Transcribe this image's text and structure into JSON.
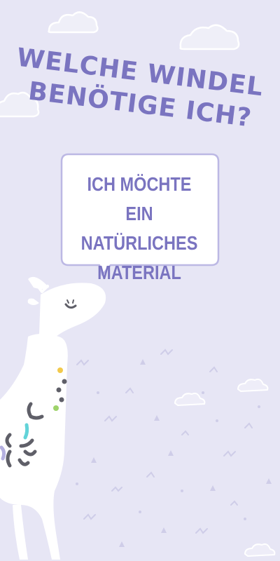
{
  "headline": {
    "line1": "WELCHE WINDEL",
    "line2": "BENÖTIGE ICH?"
  },
  "speech_bubble": {
    "line1": "ICH MÖCHTE EIN",
    "line2": "NATÜRLICHES",
    "line3": "MATERIAL"
  },
  "colors": {
    "background": "#e7e6f5",
    "accent": "#7a74c0",
    "bubble_border": "#bcb8e4",
    "spot_yellow": "#f2c94c",
    "spot_green": "#9ed36a",
    "spot_cyan": "#62d3d8",
    "spot_gray": "#5f5f68"
  },
  "icons": [
    "cloud-icon",
    "giraffe-illustration",
    "speech-bubble-shape"
  ]
}
